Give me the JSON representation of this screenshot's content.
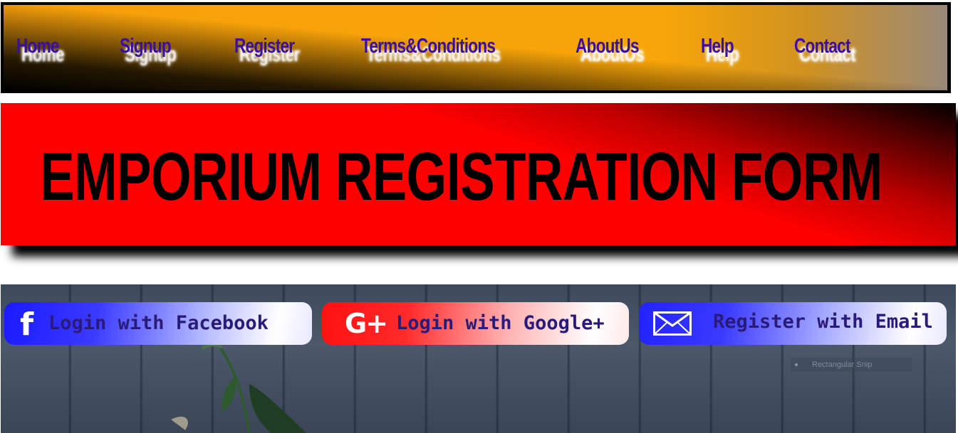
{
  "nav": {
    "items": [
      {
        "label": "Home"
      },
      {
        "label": "Signup"
      },
      {
        "label": "Register"
      },
      {
        "label": "Terms&Conditions"
      },
      {
        "label": "AboutUs"
      },
      {
        "label": "Help"
      },
      {
        "label": "Contact"
      }
    ],
    "text_color": "#3b0fa0"
  },
  "banner": {
    "title": "EMPORIUM REGISTRATION FORM",
    "bg_color": "#ff0000"
  },
  "social": {
    "facebook": {
      "label": "Login with Facebook",
      "icon": "facebook-icon",
      "color": "#1a1aff"
    },
    "google": {
      "label": "Login with Google+",
      "icon": "google-plus-icon",
      "color": "#ff1010"
    },
    "email": {
      "label": "Register with Email",
      "icon": "envelope-icon",
      "color": "#2222ff"
    }
  },
  "overlay": {
    "snip_label": "Rectangular Snip"
  }
}
